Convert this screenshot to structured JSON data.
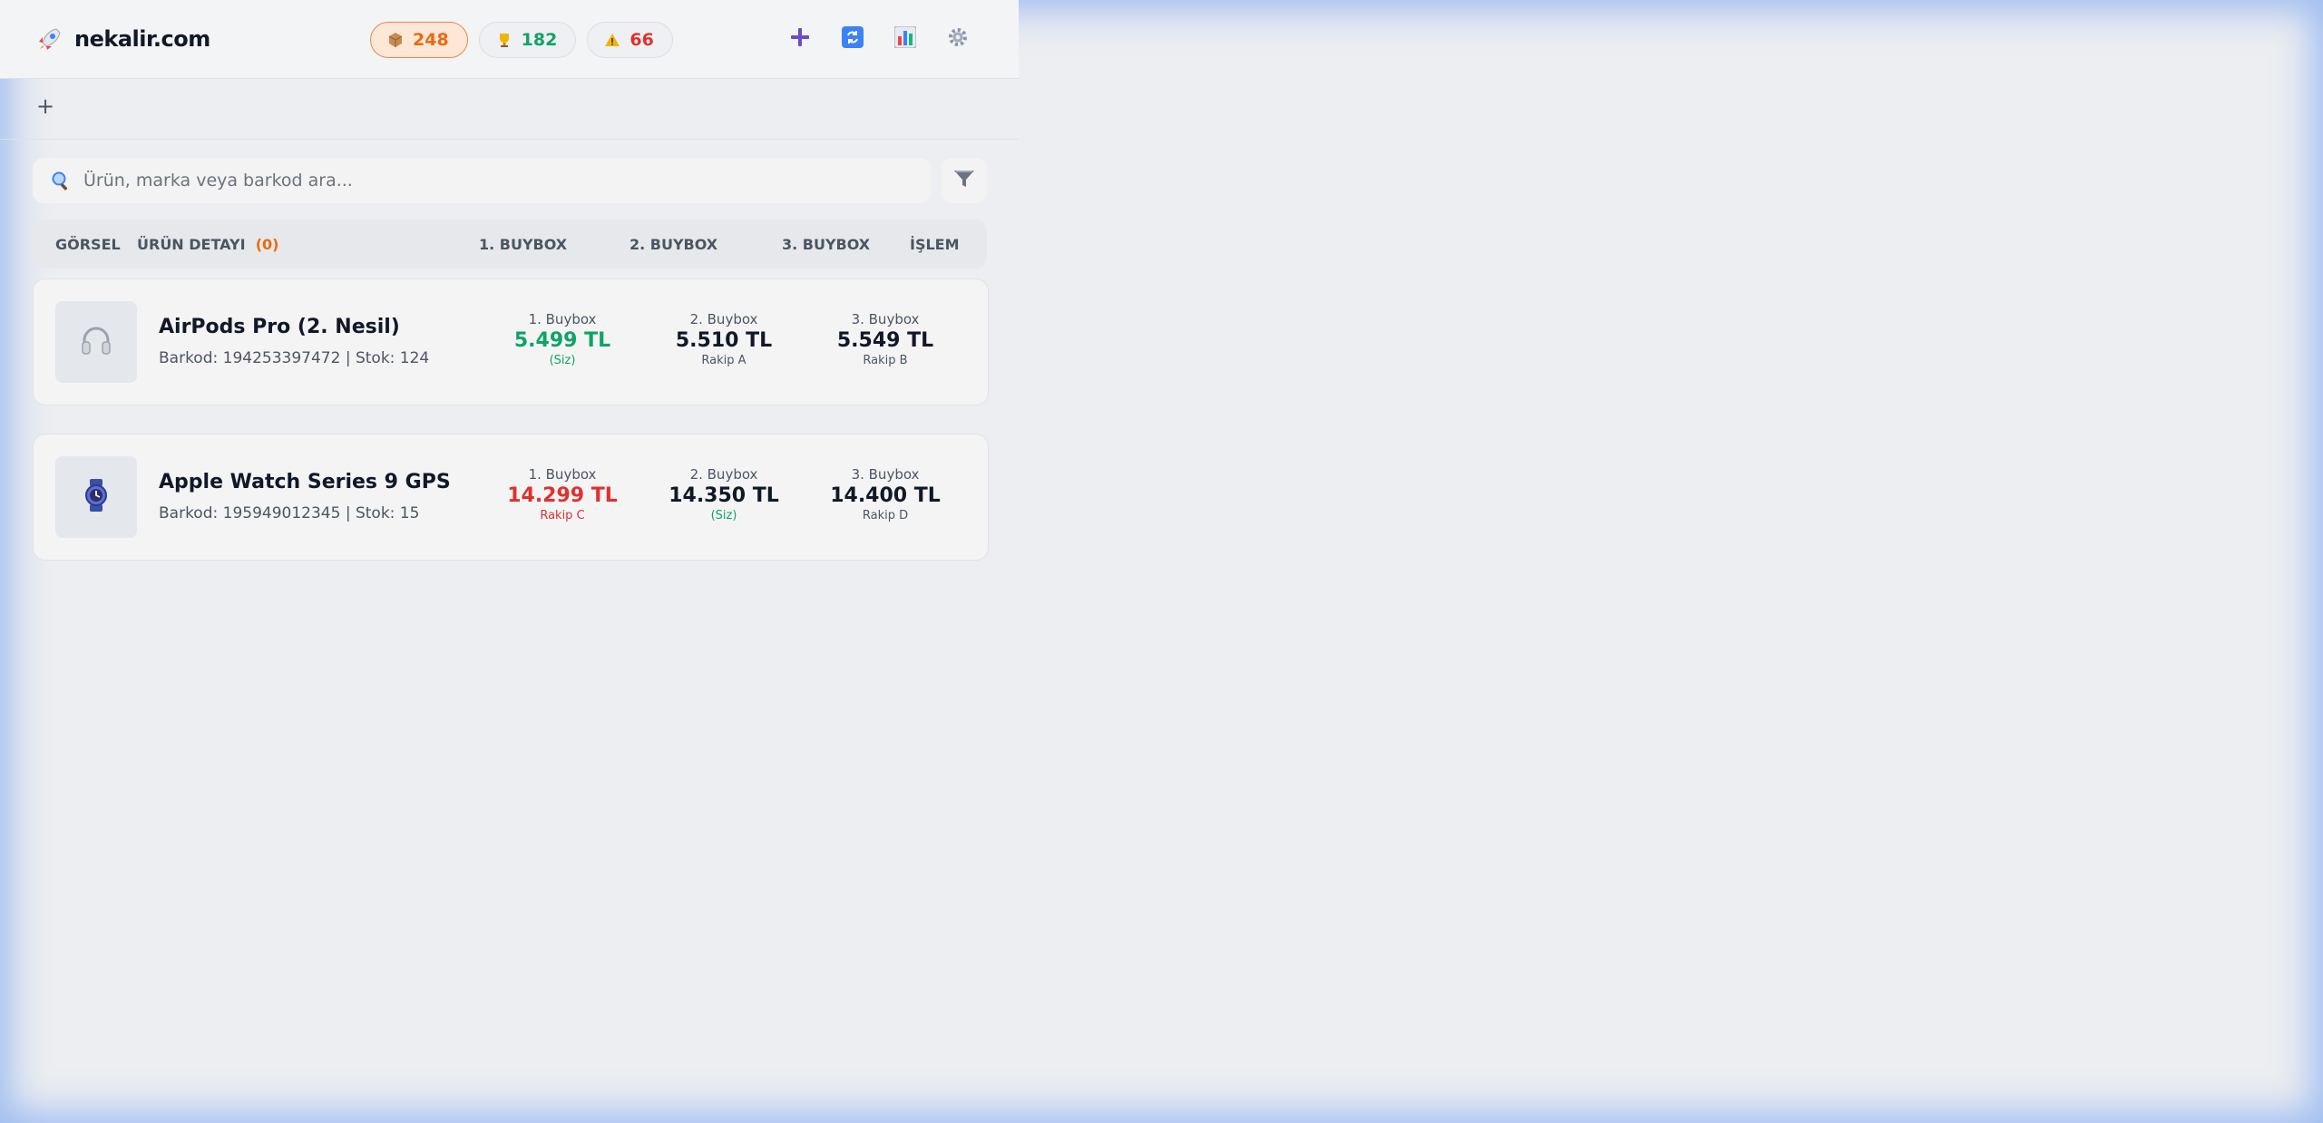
{
  "header": {
    "brand": "nekalir.com",
    "stats": [
      {
        "icon": "box-icon",
        "value": "248"
      },
      {
        "icon": "trophy-icon",
        "value": "182"
      },
      {
        "icon": "warning-icon",
        "value": "66"
      }
    ],
    "actions": [
      "add-icon",
      "refresh-icon",
      "chart-icon",
      "gear-icon"
    ]
  },
  "tabs": {
    "add_label": "+"
  },
  "search": {
    "placeholder": "Ürün, marka veya barkod ara..."
  },
  "table": {
    "columns": {
      "image": "GÖRSEL",
      "detail": "ÜRÜN DETAYI",
      "detail_count": "(0)",
      "bb1": "1. BUYBOX",
      "bb2": "2. BUYBOX",
      "bb3": "3. BUYBOX",
      "action": "İŞLEM"
    }
  },
  "products": [
    {
      "icon": "headphones-icon",
      "name": "AirPods Pro (2. Nesil)",
      "meta": "Barkod: 194253397472 | Stok: 124",
      "buybox": [
        {
          "label": "1. Buybox",
          "price": "5.499 TL",
          "seller": "(Siz)"
        },
        {
          "label": "2. Buybox",
          "price": "5.510 TL",
          "seller": "Rakip A"
        },
        {
          "label": "3. Buybox",
          "price": "5.549 TL",
          "seller": "Rakip B"
        }
      ]
    },
    {
      "icon": "watch-icon",
      "name": "Apple Watch Series 9 GPS",
      "meta": "Barkod: 195949012345 | Stok: 15",
      "buybox": [
        {
          "label": "1. Buybox",
          "price": "14.299 TL",
          "seller": "Rakip C"
        },
        {
          "label": "2. Buybox",
          "price": "14.350 TL",
          "seller": "(Siz)"
        },
        {
          "label": "3. Buybox",
          "price": "14.400 TL",
          "seller": "Rakip D"
        }
      ]
    }
  ],
  "colors": {
    "accent_orange": "#ea6a12",
    "green": "#10a366",
    "red": "#e0312f",
    "purple": "#6d4bc3"
  }
}
